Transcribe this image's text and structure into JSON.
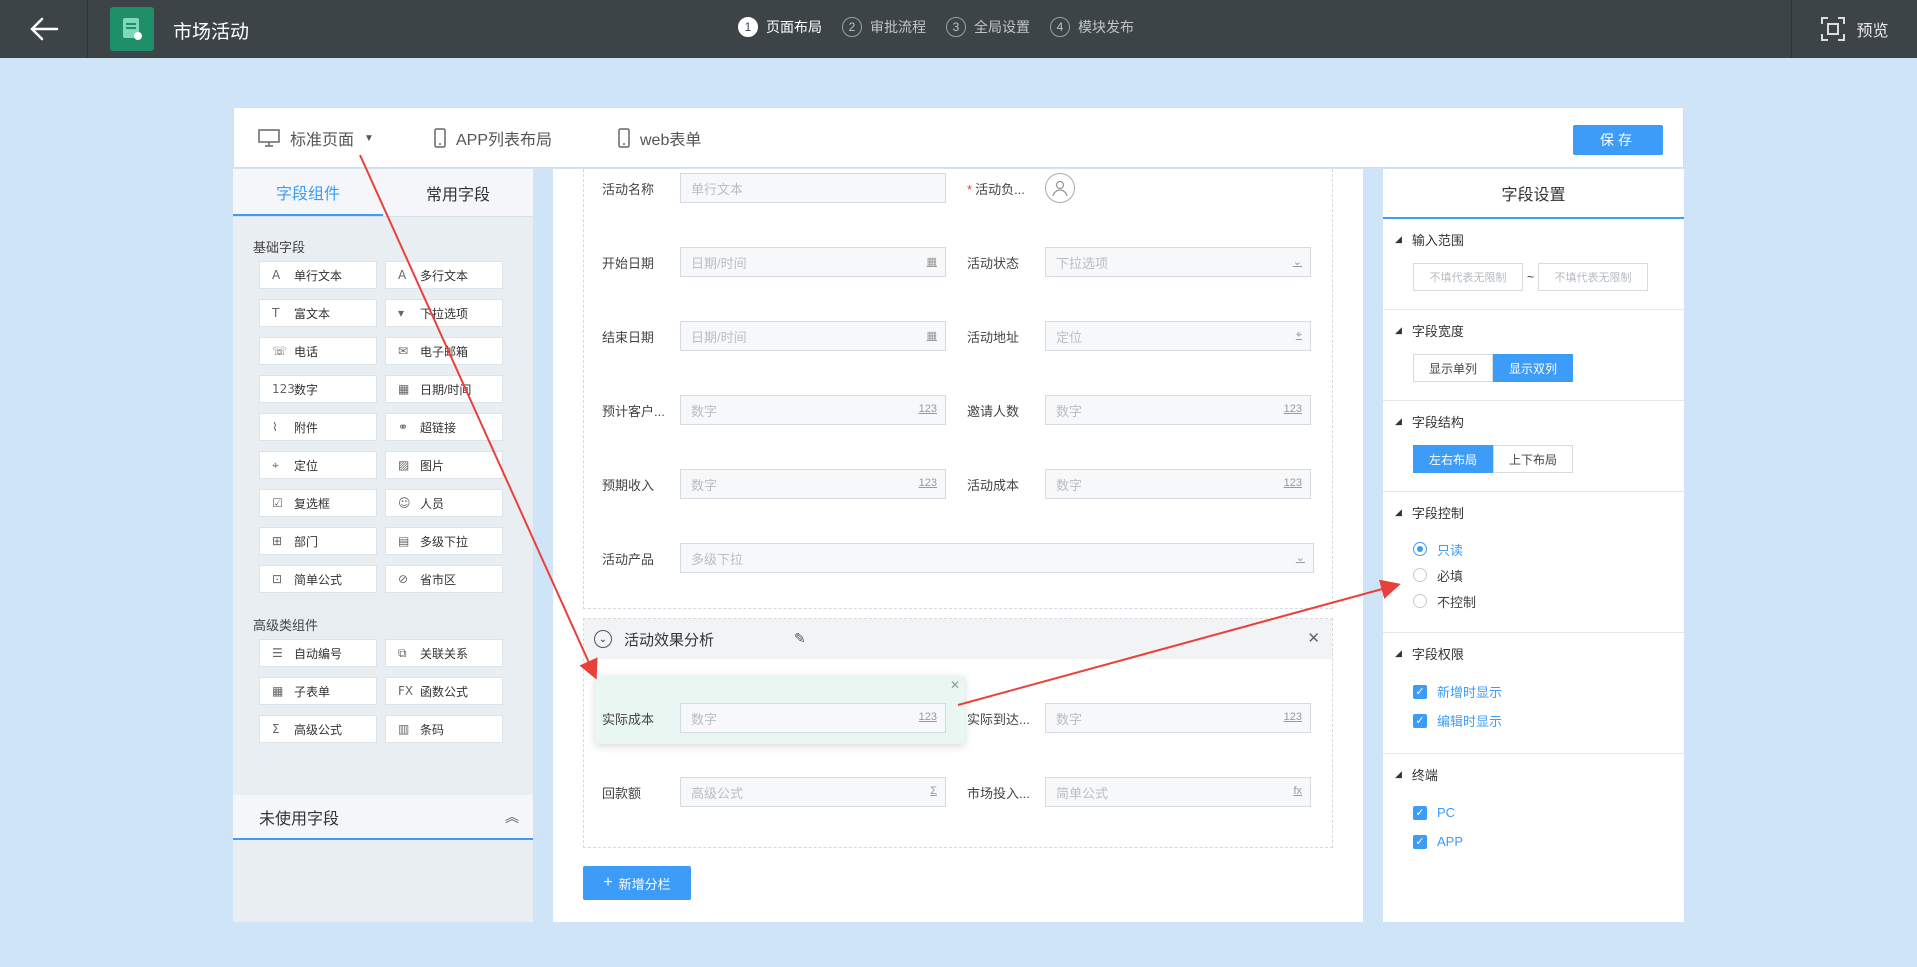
{
  "header": {
    "app_title": "市场活动",
    "preview_label": "预览",
    "steps": [
      {
        "num": "1",
        "label": "页面布局",
        "active": true
      },
      {
        "num": "2",
        "label": "审批流程"
      },
      {
        "num": "3",
        "label": "全局设置"
      },
      {
        "num": "4",
        "label": "模块发布"
      }
    ]
  },
  "view_tabs": [
    {
      "label": "标准页面"
    },
    {
      "label": "APP列表布局"
    },
    {
      "label": "web表单"
    }
  ],
  "save_label": "保存",
  "left": {
    "tabs": [
      "字段组件",
      "常用字段"
    ],
    "basic_title": "基础字段",
    "basic": [
      {
        "label": "单行文本",
        "icon": "A"
      },
      {
        "label": "多行文本",
        "icon": "A"
      },
      {
        "label": "富文本",
        "icon": "T"
      },
      {
        "label": "下拉选项",
        "icon": "▾"
      },
      {
        "label": "电话",
        "icon": "☏"
      },
      {
        "label": "电子邮箱",
        "icon": "✉"
      },
      {
        "label": "数字",
        "icon": "123"
      },
      {
        "label": "日期/时间",
        "icon": "▦"
      },
      {
        "label": "附件",
        "icon": "⌇"
      },
      {
        "label": "超链接",
        "icon": "⚭"
      },
      {
        "label": "定位",
        "icon": "⌖"
      },
      {
        "label": "图片",
        "icon": "▨"
      },
      {
        "label": "复选框",
        "icon": "☑"
      },
      {
        "label": "人员",
        "icon": "☺"
      },
      {
        "label": "部门",
        "icon": "⊞"
      },
      {
        "label": "多级下拉",
        "icon": "▤"
      },
      {
        "label": "简单公式",
        "icon": "⊡"
      },
      {
        "label": "省市区",
        "icon": "⊘"
      }
    ],
    "advanced_title": "高级类组件",
    "advanced": [
      {
        "label": "自动编号",
        "icon": "☰"
      },
      {
        "label": "关联关系",
        "icon": "⧉"
      },
      {
        "label": "子表单",
        "icon": "▦"
      },
      {
        "label": "函数公式",
        "icon": "FX"
      },
      {
        "label": "高级公式",
        "icon": "Σ"
      },
      {
        "label": "条码",
        "icon": "▥"
      }
    ],
    "unused_label": "未使用字段"
  },
  "canvas": {
    "fields": [
      {
        "label": "活动名称",
        "placeholder": "单行文本"
      },
      {
        "label": "活动负...",
        "required": true,
        "type": "person"
      },
      {
        "label": "开始日期",
        "placeholder": "日期/时间",
        "suffix": "▦"
      },
      {
        "label": "活动状态",
        "placeholder": "下拉选项",
        "suffix": "⌄"
      },
      {
        "label": "结束日期",
        "placeholder": "日期/时间",
        "suffix": "▦"
      },
      {
        "label": "活动地址",
        "placeholder": "定位",
        "suffix": "⌖"
      },
      {
        "label": "预计客户...",
        "placeholder": "数字",
        "suffix": "123"
      },
      {
        "label": "邀请人数",
        "placeholder": "数字",
        "suffix": "123"
      },
      {
        "label": "预期收入",
        "placeholder": "数字",
        "suffix": "123"
      },
      {
        "label": "活动成本",
        "placeholder": "数字",
        "suffix": "123"
      },
      {
        "label": "活动产品",
        "placeholder": "多级下拉",
        "suffix": "⌄"
      }
    ],
    "section2_title": "活动效果分析",
    "section2_fields": [
      {
        "label": "实际成本",
        "placeholder": "数字",
        "suffix": "123"
      },
      {
        "label": "实际到达...",
        "placeholder": "数字",
        "suffix": "123"
      },
      {
        "label": "回款额",
        "placeholder": "高级公式",
        "suffix": "Σ"
      },
      {
        "label": "市场投入...",
        "placeholder": "简单公式",
        "suffix": "fx"
      }
    ],
    "add_column_label": "新增分栏"
  },
  "right": {
    "title": "字段设置",
    "range_title": "输入范围",
    "range_min_placeholder": "不填代表无限制",
    "range_sep": "~",
    "range_max_placeholder": "不填代表无限制",
    "width_title": "字段宽度",
    "width_options": [
      "显示单列",
      "显示双列"
    ],
    "width_selected": 1,
    "structure_title": "字段结构",
    "structure_options": [
      "左右布局",
      "上下布局"
    ],
    "structure_selected": 0,
    "control_title": "字段控制",
    "control_options": [
      "只读",
      "必填",
      "不控制"
    ],
    "control_selected": 0,
    "permission_title": "字段权限",
    "permission_options": [
      "新增时显示",
      "编辑时显示"
    ],
    "terminal_title": "终端",
    "terminal_options": [
      "PC",
      "APP"
    ]
  },
  "colors": {
    "topbar": "#3d4448",
    "accent": "#3c9cf7",
    "annotation_arrow": "#e8413a",
    "page_bg": "#cfe4f7"
  }
}
